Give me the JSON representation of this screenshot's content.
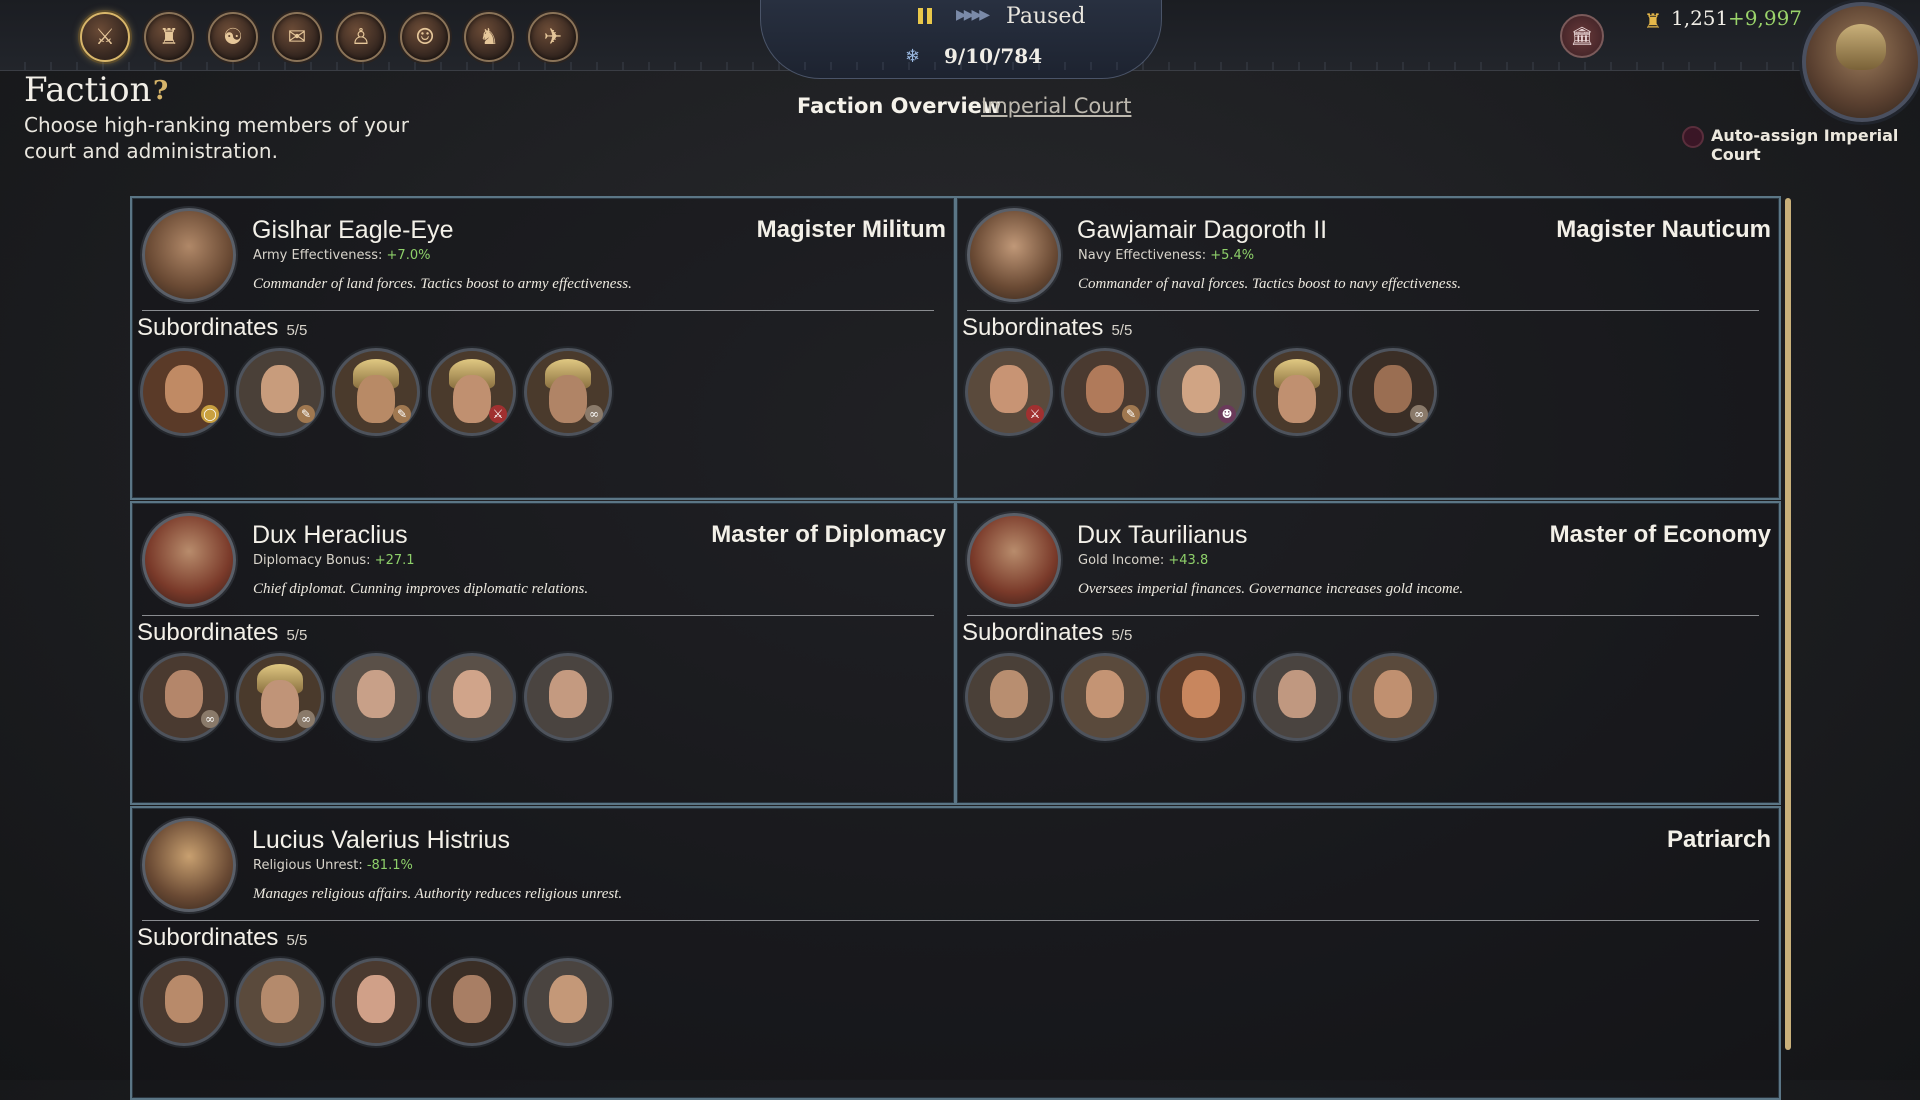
{
  "topbar": {
    "nav_icons": [
      {
        "name": "military-icon",
        "glyph": "⚔",
        "active": true
      },
      {
        "name": "army-icon",
        "glyph": "♜",
        "active": false
      },
      {
        "name": "diplomacy-icon",
        "glyph": "☯",
        "active": false
      },
      {
        "name": "scroll-icon",
        "glyph": "✉",
        "active": false
      },
      {
        "name": "bust-icon",
        "glyph": "♙",
        "active": false
      },
      {
        "name": "character-icon",
        "glyph": "☺",
        "active": false
      },
      {
        "name": "soldiers-icon",
        "glyph": "♞",
        "active": false
      },
      {
        "name": "map-icon",
        "glyph": "✈",
        "active": false
      }
    ],
    "status": "Paused",
    "date": "9/10/784",
    "gold": "1,251",
    "gold_income": "+9,997"
  },
  "header": {
    "title": "Faction",
    "help": "?",
    "subtitle": "Choose high-ranking members of your court and administration.",
    "tabs": [
      "Faction Overview",
      "Imperial Court"
    ],
    "auto_assign_label": "Auto-assign Imperial Court"
  },
  "positions": [
    {
      "leader": "Gislhar Eagle-Eye",
      "stat_label": "Army Effectiveness:",
      "stat_value": "+7.0%",
      "description": "Commander of land forces. Tactics boost to army effectiveness.",
      "role": "Magister Militum",
      "subordinates_label": "Subordinates",
      "subordinates_count": "5/5"
    },
    {
      "leader": "Gawjamair Dagoroth II",
      "stat_label": "Navy Effectiveness:",
      "stat_value": "+5.4%",
      "description": "Commander of naval forces. Tactics boost to navy effectiveness.",
      "role": "Magister Nauticum",
      "subordinates_label": "Subordinates",
      "subordinates_count": "5/5"
    },
    {
      "leader": "Dux Heraclius",
      "stat_label": "Diplomacy Bonus:",
      "stat_value": "+27.1",
      "description": "Chief diplomat. Cunning improves diplomatic relations.",
      "role": "Master of Diplomacy",
      "subordinates_label": "Subordinates",
      "subordinates_count": "5/5"
    },
    {
      "leader": "Dux Taurilianus",
      "stat_label": "Gold Income:",
      "stat_value": "+43.8",
      "description": "Oversees imperial finances. Governance increases gold income.",
      "role": "Master of Economy",
      "subordinates_label": "Subordinates",
      "subordinates_count": "5/5"
    },
    {
      "leader": "Lucius Valerius Histrius",
      "stat_label": "Religious Unrest:",
      "stat_value": "-81.1%",
      "description": "Manages religious affairs. Authority reduces religious unrest.",
      "role": "Patriarch",
      "subordinates_label": "Subordinates",
      "subordinates_count": "5/5"
    }
  ],
  "colors": {
    "accent_gold": "#d6b46a",
    "stat_green": "#8ed06a",
    "panel_border": "#5b7686",
    "scrollbar": "#c9b07a"
  }
}
